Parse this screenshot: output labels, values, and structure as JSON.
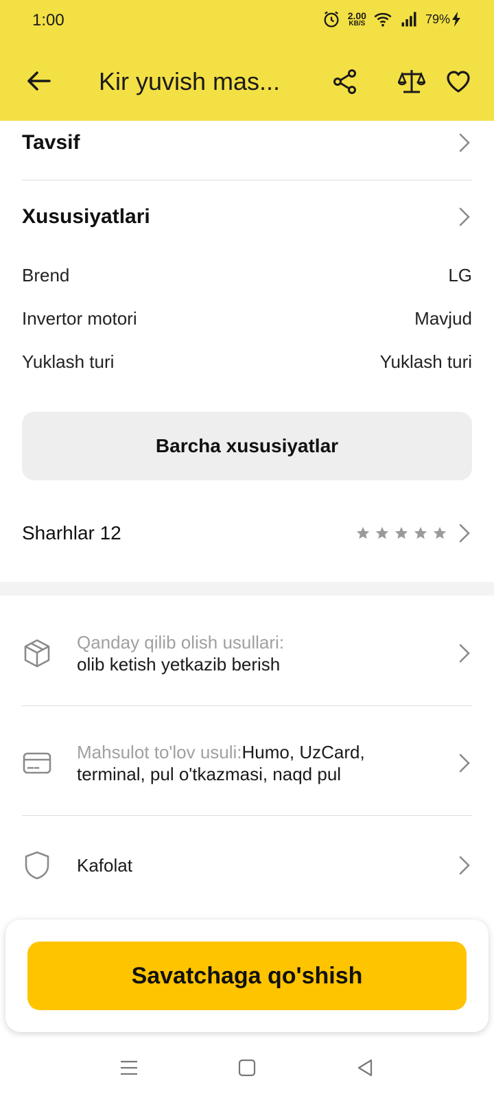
{
  "status_bar": {
    "time": "1:00",
    "net_speed_value": "2.00",
    "net_speed_unit": "KB/S",
    "battery": "79%",
    "icons": [
      "alarm-icon",
      "wifi-icon",
      "signal-icon",
      "charging-icon"
    ]
  },
  "header": {
    "title": "Kir yuvish mas...",
    "icons": [
      "back-arrow-icon",
      "share-icon",
      "compare-scales-icon",
      "heart-icon"
    ]
  },
  "sections": {
    "description_title": "Tavsif",
    "specs_title": "Xususiyatlari"
  },
  "specs": [
    {
      "label": "Brend",
      "value": "LG"
    },
    {
      "label": "Invertor motori",
      "value": "Mavjud"
    },
    {
      "label": "Yuklash turi",
      "value": "Yuklash turi"
    }
  ],
  "all_specs_button": "Barcha xususiyatlar",
  "reviews": {
    "label": "Sharhlar 12",
    "rating_stars": 0,
    "max_stars": 5
  },
  "info": {
    "delivery": {
      "label": "Qanday qilib olish usullari:",
      "value": "olib ketish yetkazib berish",
      "icon": "box-icon"
    },
    "payment": {
      "label": "Mahsulot to'lov usuli:",
      "value_line1": "Humo, UzCard,",
      "value_line2": "terminal, pul o'tkazmasi, naqd pul",
      "icon": "credit-card-icon"
    },
    "warranty": {
      "label": "Kafolat",
      "icon": "shield-icon"
    }
  },
  "cta": {
    "label": "Savatchaga qo'shish",
    "color": "#FFC400"
  },
  "colors": {
    "header_bg": "#F3E044",
    "muted_text": "#A0A0A0"
  },
  "system_nav": [
    "menu-icon",
    "home-square-icon",
    "back-triangle-icon"
  ]
}
